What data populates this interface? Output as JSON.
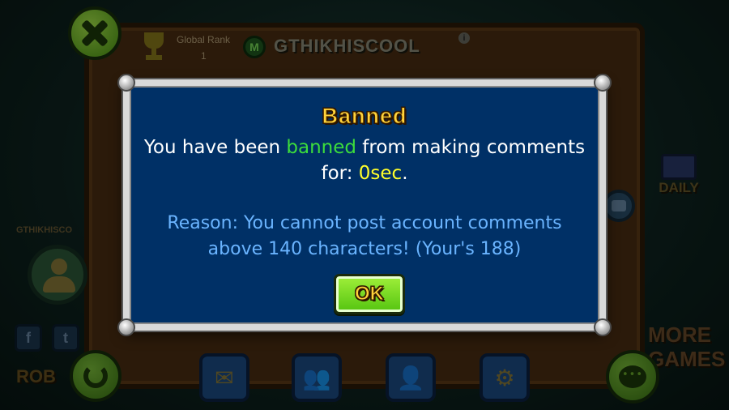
{
  "profile": {
    "global_rank_label": "Global Rank",
    "global_rank_value": "1",
    "mod_badge": "M",
    "username": "GTHIKHISCOOL",
    "left_username": "GTHIKHISCO",
    "info_icon": "i",
    "social_facebook": "f",
    "social_twitter": "t",
    "rob_label": "ROB",
    "daily_label": "DAILY",
    "more_games_label": "MORE GAMES"
  },
  "icons": {
    "close": "close-icon",
    "trophy": "trophy-icon",
    "refresh": "refresh-icon",
    "mail": "mail-icon",
    "friends": "friends-icon",
    "add_friend": "add-friend-icon",
    "settings": "gear-icon",
    "chat": "chat-icon",
    "comment_toggle": "comment-icon"
  },
  "dialog": {
    "title": "Banned",
    "line1_pre": "You have been ",
    "line1_highlight": "banned",
    "line1_post": " from making comments",
    "line2_pre": "for: ",
    "line2_highlight": "0sec",
    "line2_post": ".",
    "reason": "Reason: You cannot post account comments above 140 characters! (Your's 188)",
    "ok_label": "OK"
  },
  "colors": {
    "dialog_bg": "#003066",
    "title": "#ffd23a",
    "highlight_green": "#3cdc3c",
    "highlight_yellow": "#ffff2a",
    "reason": "#6ab4ff",
    "ok_button": "#7ad424"
  }
}
